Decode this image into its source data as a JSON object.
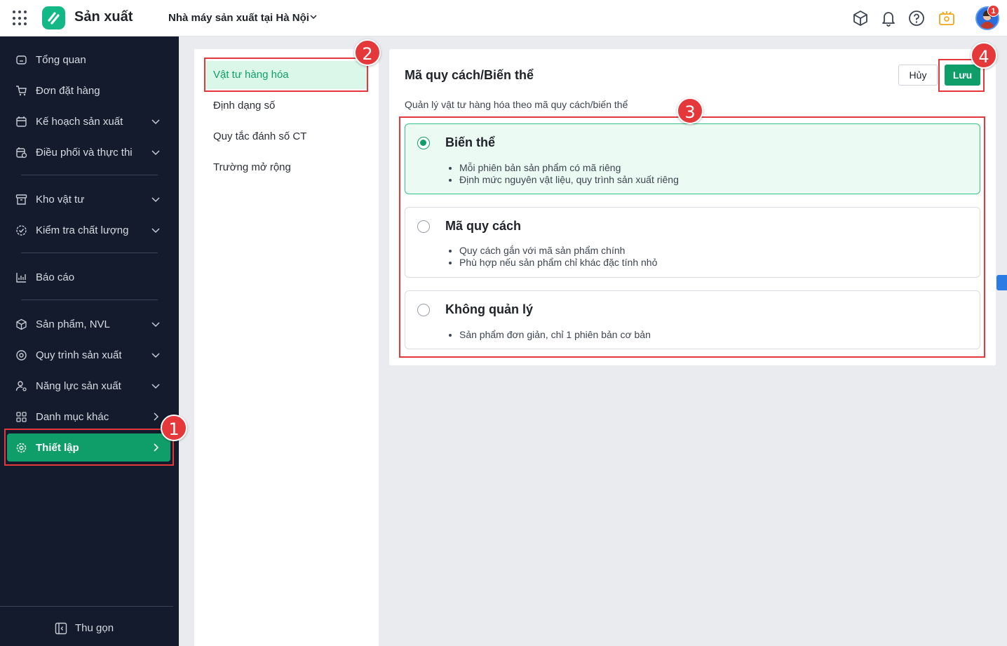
{
  "header": {
    "app_title": "Sản xuất",
    "factory": "Nhà máy sản xuất tại Hà Nội",
    "notification_count": "1"
  },
  "sidebar": {
    "items": [
      {
        "label": "Tổng quan",
        "icon": "home-icon"
      },
      {
        "label": "Đơn đặt hàng",
        "icon": "cart-icon"
      },
      {
        "label": "Kế hoạch sản xuất",
        "icon": "calendar-icon"
      },
      {
        "label": "Điều phối và thực thi",
        "icon": "calendar-clock-icon"
      },
      {
        "label": "Kho vật tư",
        "icon": "archive-icon"
      },
      {
        "label": "Kiểm tra chất lượng",
        "icon": "quality-check-icon"
      },
      {
        "label": "Báo cáo",
        "icon": "chart-icon"
      },
      {
        "label": "Sản phẩm, NVL",
        "icon": "cube-icon"
      },
      {
        "label": "Quy trình sản xuất",
        "icon": "process-icon"
      },
      {
        "label": "Năng lực sản xuất",
        "icon": "user-gear-icon"
      },
      {
        "label": "Danh mục khác",
        "icon": "grid-icon"
      },
      {
        "label": "Thiết lập",
        "icon": "gear-icon"
      }
    ],
    "collapse_label": "Thu gọn"
  },
  "submenu": {
    "items": [
      {
        "label": "Vật tư hàng hóa"
      },
      {
        "label": "Định dạng số"
      },
      {
        "label": "Quy tắc đánh số CT"
      },
      {
        "label": "Trường mở rộng"
      }
    ]
  },
  "panel": {
    "title": "Mã quy cách/Biến thể",
    "description": "Quản lý vật tư hàng hóa theo mã quy cách/biến thể",
    "cancel_label": "Hủy",
    "save_label": "Lưu",
    "options": [
      {
        "title": "Biến thể",
        "selected": true,
        "bullets": [
          "Mỗi phiên bản sản phẩm có mã riêng",
          "Định mức nguyên vật liệu, quy trình sản xuất riêng"
        ]
      },
      {
        "title": "Mã quy cách",
        "selected": false,
        "bullets": [
          "Quy cách gắn với mã sản phẩm chính",
          "Phù hợp nếu sản phẩm chỉ khác đặc tính nhỏ"
        ]
      },
      {
        "title": "Không quản lý",
        "selected": false,
        "bullets": [
          "Sản phẩm đơn giản, chỉ 1 phiên bản cơ bản"
        ]
      }
    ]
  },
  "callouts": [
    "1",
    "2",
    "3",
    "4"
  ],
  "colors": {
    "accent": "#0f9e6a",
    "sidebar_bg": "#141b2d",
    "highlight": "#e5383b"
  }
}
